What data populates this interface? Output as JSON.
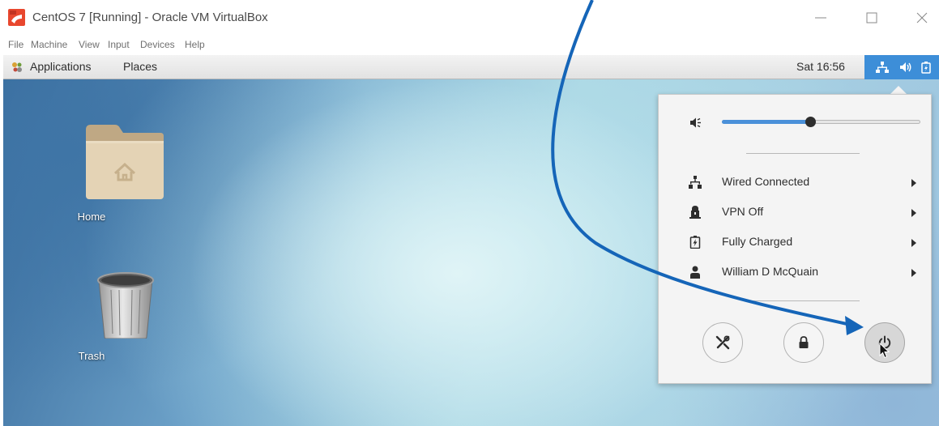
{
  "window": {
    "title": "CentOS 7 [Running] - Oracle VM VirtualBox",
    "controls": {
      "minimize": "minimize",
      "maximize": "maximize",
      "close": "close"
    }
  },
  "menubar": {
    "items": [
      "File",
      "Machine",
      "View",
      "Input",
      "Devices",
      "Help"
    ]
  },
  "gnome_bar": {
    "applications_label": "Applications",
    "places_label": "Places",
    "clock": "Sat 16:56",
    "status_icons": [
      "network-wired-icon",
      "speaker-icon",
      "battery-icon"
    ],
    "status_area_color": "#3d8ed8"
  },
  "desktop": {
    "icons": [
      {
        "label": "Home",
        "icon": "home-folder-icon"
      },
      {
        "label": "Trash",
        "icon": "trash-icon"
      }
    ]
  },
  "system_menu": {
    "volume": {
      "icon": "speaker-icon",
      "level": 0.45
    },
    "rows": [
      {
        "label": "Wired Connected",
        "icon": "network-wired-icon"
      },
      {
        "label": "VPN Off",
        "icon": "vpn-lock-icon"
      },
      {
        "label": "Fully Charged",
        "icon": "battery-icon"
      },
      {
        "label": "William D McQuain",
        "icon": "user-icon"
      }
    ],
    "buttons": [
      {
        "name": "settings",
        "icon": "settings-tools-icon"
      },
      {
        "name": "lock",
        "icon": "lock-icon"
      },
      {
        "name": "power-off",
        "icon": "power-icon"
      }
    ]
  },
  "annotation": {
    "arrow_color": "#1565b8"
  }
}
